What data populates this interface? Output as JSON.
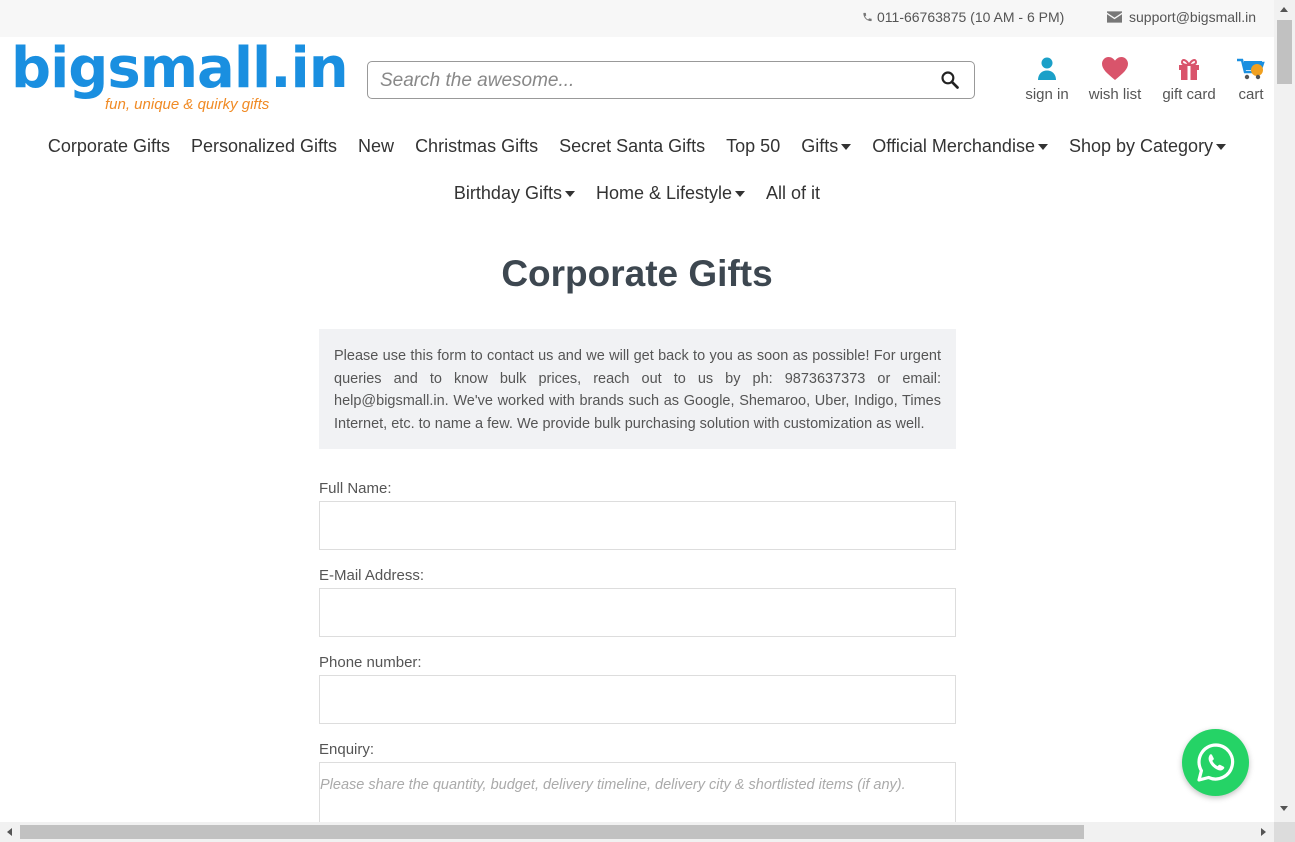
{
  "topbar": {
    "phone": "011-66763875 (10 AM - 6 PM)",
    "email": "support@bigsmall.in"
  },
  "logo": {
    "brand": "bigsmall.in",
    "tagline": "fun, unique & quirky gifts"
  },
  "search": {
    "placeholder": "Search the awesome..."
  },
  "header_links": {
    "sign_in": "sign in",
    "wish_list": "wish list",
    "gift_card": "gift card",
    "cart": "cart"
  },
  "nav": {
    "row1": [
      {
        "label": "Corporate Gifts",
        "dropdown": false
      },
      {
        "label": "Personalized Gifts",
        "dropdown": false
      },
      {
        "label": "New",
        "dropdown": false
      },
      {
        "label": "Christmas Gifts",
        "dropdown": false
      },
      {
        "label": "Secret Santa Gifts",
        "dropdown": false
      },
      {
        "label": "Top 50",
        "dropdown": false
      },
      {
        "label": "Gifts",
        "dropdown": true
      },
      {
        "label": "Official Merchandise",
        "dropdown": true
      },
      {
        "label": "Shop by Category",
        "dropdown": true
      }
    ],
    "row2": [
      {
        "label": "Birthday Gifts",
        "dropdown": true
      },
      {
        "label": "Home & Lifestyle",
        "dropdown": true
      },
      {
        "label": "All of it",
        "dropdown": false
      }
    ]
  },
  "main": {
    "title": "Corporate Gifts",
    "notice": "Please use this form to contact us and we will get back to you as soon as possible! For urgent queries and to know bulk prices, reach out to us by ph: 9873637373 or email: help@bigsmall.in. We've worked with brands such as Google, Shemaroo, Uber, Indigo, Times Internet, etc. to name a few. We provide bulk purchasing solution with customization as well.",
    "form": {
      "full_name_label": "Full Name:",
      "full_name_value": "",
      "email_label": "E-Mail Address:",
      "email_value": "",
      "phone_label": "Phone number:",
      "phone_value": "",
      "enquiry_label": "Enquiry:",
      "enquiry_placeholder": "Please share the quantity, budget, delivery timeline, delivery city & shortlisted items (if any)."
    }
  },
  "colors": {
    "brand_blue": "#1a8fe0",
    "brand_orange": "#f08a24",
    "signin_icon": "#1ba0c8",
    "heart_icon": "#d9546b",
    "gift_icon": "#d9546b",
    "whatsapp": "#25d366"
  },
  "icons": {
    "phone": "phone-icon",
    "mail": "envelope-icon",
    "search": "search-icon",
    "sign_in": "user-icon",
    "wish_list": "heart-icon",
    "gift_card": "gift-icon",
    "cart": "cart-icon",
    "whatsapp": "whatsapp-icon"
  }
}
